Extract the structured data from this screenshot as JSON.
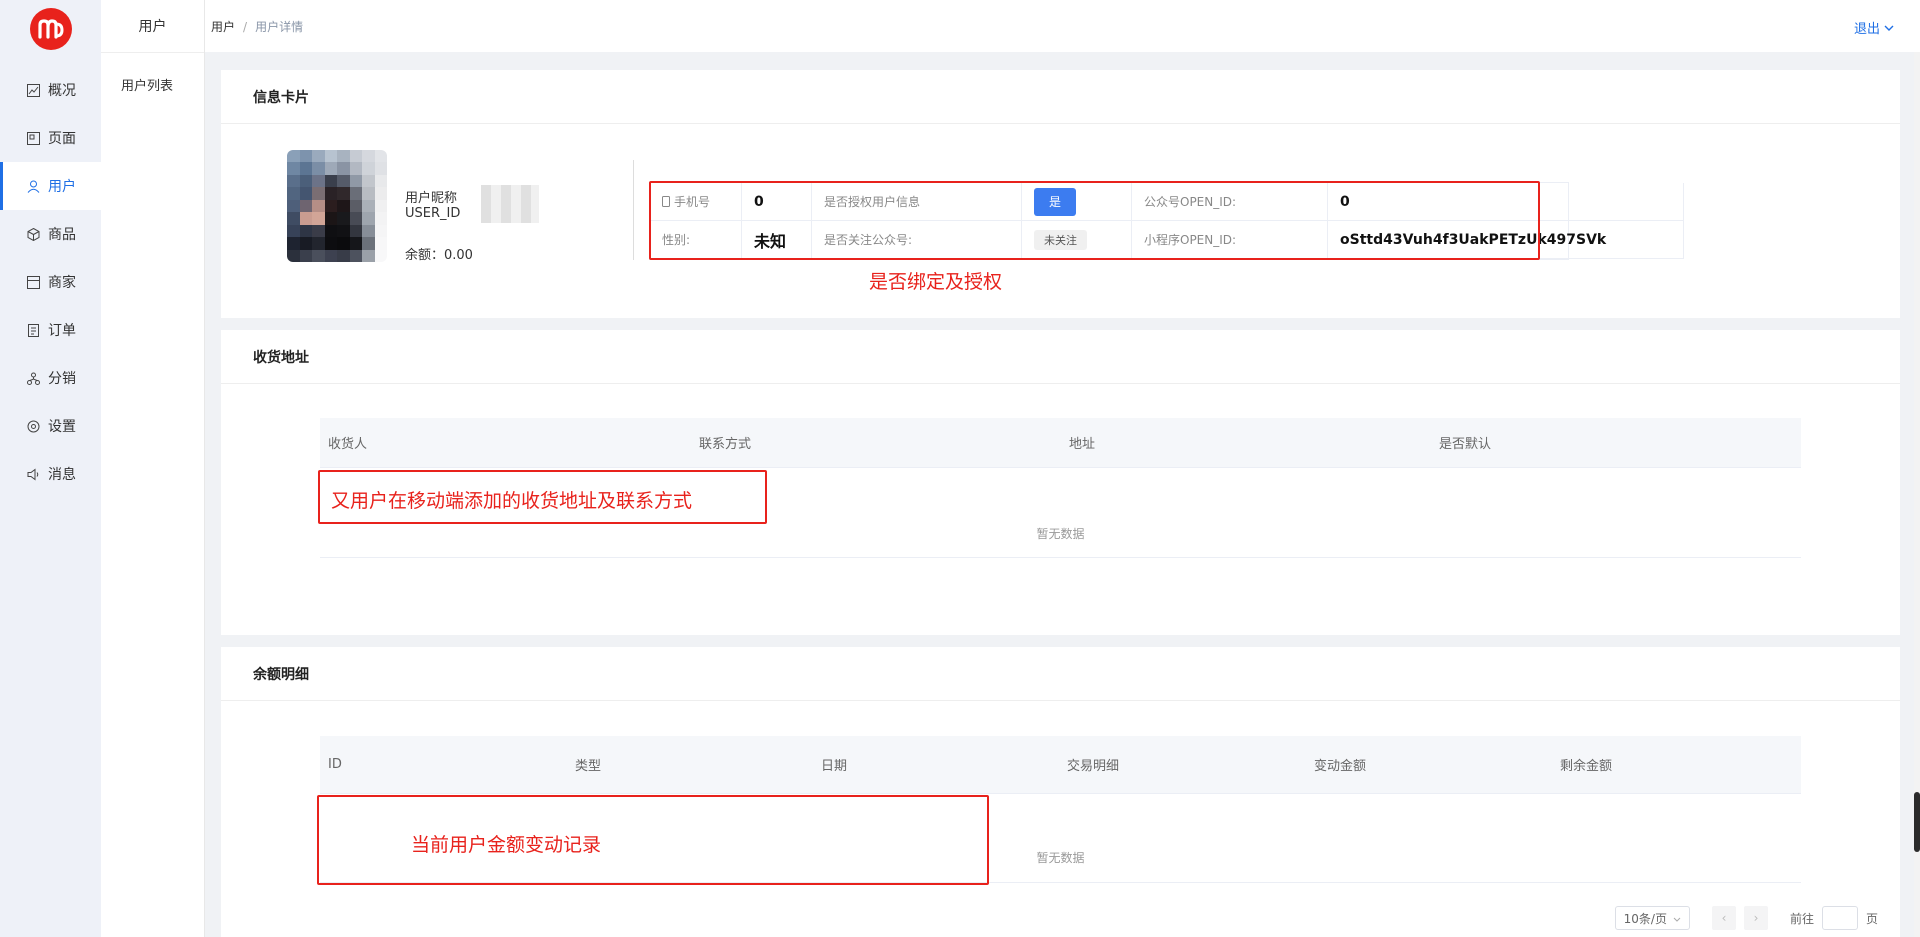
{
  "sidebar": {
    "items": [
      {
        "label": "概况",
        "icon": "chart-icon"
      },
      {
        "label": "页面",
        "icon": "page-icon"
      },
      {
        "label": "用户",
        "icon": "user-icon"
      },
      {
        "label": "商品",
        "icon": "box-icon"
      },
      {
        "label": "商家",
        "icon": "store-icon"
      },
      {
        "label": "订单",
        "icon": "order-icon"
      },
      {
        "label": "分销",
        "icon": "network-icon"
      },
      {
        "label": "设置",
        "icon": "settings-icon"
      },
      {
        "label": "消息",
        "icon": "speaker-icon"
      }
    ],
    "active_index": 2
  },
  "subnav": {
    "title": "用户",
    "items": [
      "用户列表"
    ]
  },
  "breadcrumb": {
    "root": "用户",
    "sep": "/",
    "current": "用户详情"
  },
  "header": {
    "logout": "退出"
  },
  "colors": {
    "accent": "#1f6fe5",
    "annotation": "#e8221c",
    "logo": "#e8221c"
  },
  "info_card": {
    "title": "信息卡片",
    "nickname_label": "用户昵称",
    "userid_label": "USER_ID",
    "balance": "余额：0.00",
    "phone_label": "手机号",
    "phone_value": "0",
    "authorized_label": "是否授权用户信息",
    "authorized_value": "是",
    "oa_openid_label": "公众号OPEN_ID:",
    "oa_openid_value": "0",
    "gender_label": "性别:",
    "gender_value": "未知",
    "follow_label": "是否关注公众号:",
    "follow_value": "未关注",
    "mini_openid_label": "小程序OPEN_ID:",
    "mini_openid_value": "oSttd43Vuh4f3UakPETzUk497SVk",
    "annotation": "是否绑定及授权"
  },
  "address_card": {
    "title": "收货地址",
    "columns": [
      "收货人",
      "联系方式",
      "地址",
      "是否默认"
    ],
    "empty": "暂无数据",
    "annotation": "又用户在移动端添加的收货地址及联系方式"
  },
  "balance_card": {
    "title": "余额明细",
    "columns": [
      "ID",
      "类型",
      "日期",
      "交易明细",
      "变动金额",
      "剩余金额"
    ],
    "empty": "暂无数据",
    "annotation": "当前用户金额变动记录",
    "pager": {
      "size": "10条/页",
      "goto": "前往",
      "page": "页"
    }
  }
}
